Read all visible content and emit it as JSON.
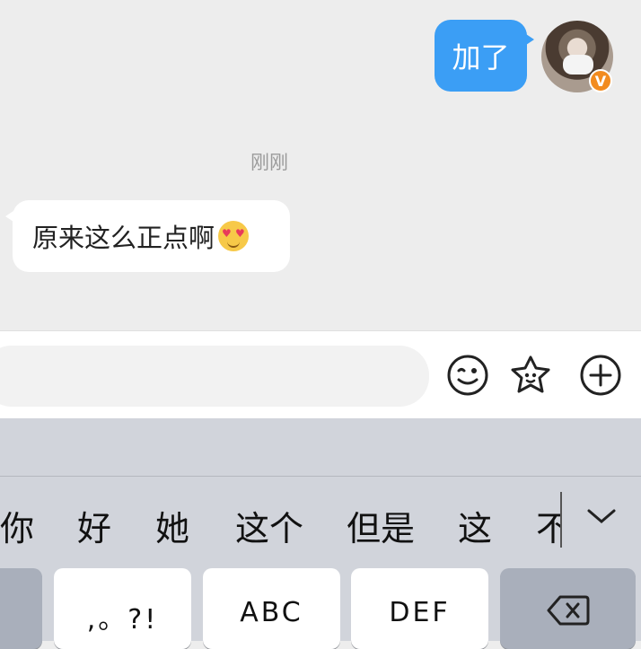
{
  "chat": {
    "outgoing_message": "加了",
    "timestamp": "刚刚",
    "incoming_message": "原来这么正点啊",
    "incoming_emoji": "heart-eyes-emoji"
  },
  "composer": {
    "placeholder": "",
    "tools": [
      "emoji-icon",
      "sticker-icon",
      "plus-icon"
    ]
  },
  "keyboard": {
    "candidates": [
      "你",
      "好",
      "她",
      "这个",
      "但是",
      "这",
      "不"
    ],
    "keys": [
      ",。?!",
      "ABC",
      "DEF"
    ],
    "delete_icon": "backspace-icon"
  },
  "colors": {
    "outgoing_bubble": "#3b9ef5",
    "chat_background": "#ededed",
    "keyboard_background": "#d1d4db",
    "verified_badge": "#f28b1f"
  }
}
